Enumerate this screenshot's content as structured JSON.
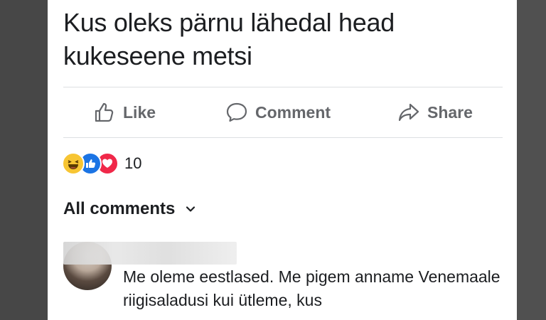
{
  "post": {
    "text": "Kus oleks pärnu lähedal head kukeseene metsi"
  },
  "actions": {
    "like_label": "Like",
    "comment_label": "Comment",
    "share_label": "Share"
  },
  "reactions": {
    "icons": [
      "haha-icon",
      "like-icon",
      "love-icon"
    ],
    "count": "10"
  },
  "comments": {
    "header_label": "All comments",
    "first_comment_text": "Me oleme eestlased. Me pigem anname Venemaale riigisaladusi kui ütleme, kus"
  },
  "colors": {
    "background": "#4b4b4b",
    "card": "#ffffff",
    "text": "#1c1e21",
    "muted": "#65676b",
    "divider": "#dddfe2",
    "like_blue": "#1b74e4",
    "love_red": "#f02849",
    "haha_yellow": "#f7c533"
  }
}
